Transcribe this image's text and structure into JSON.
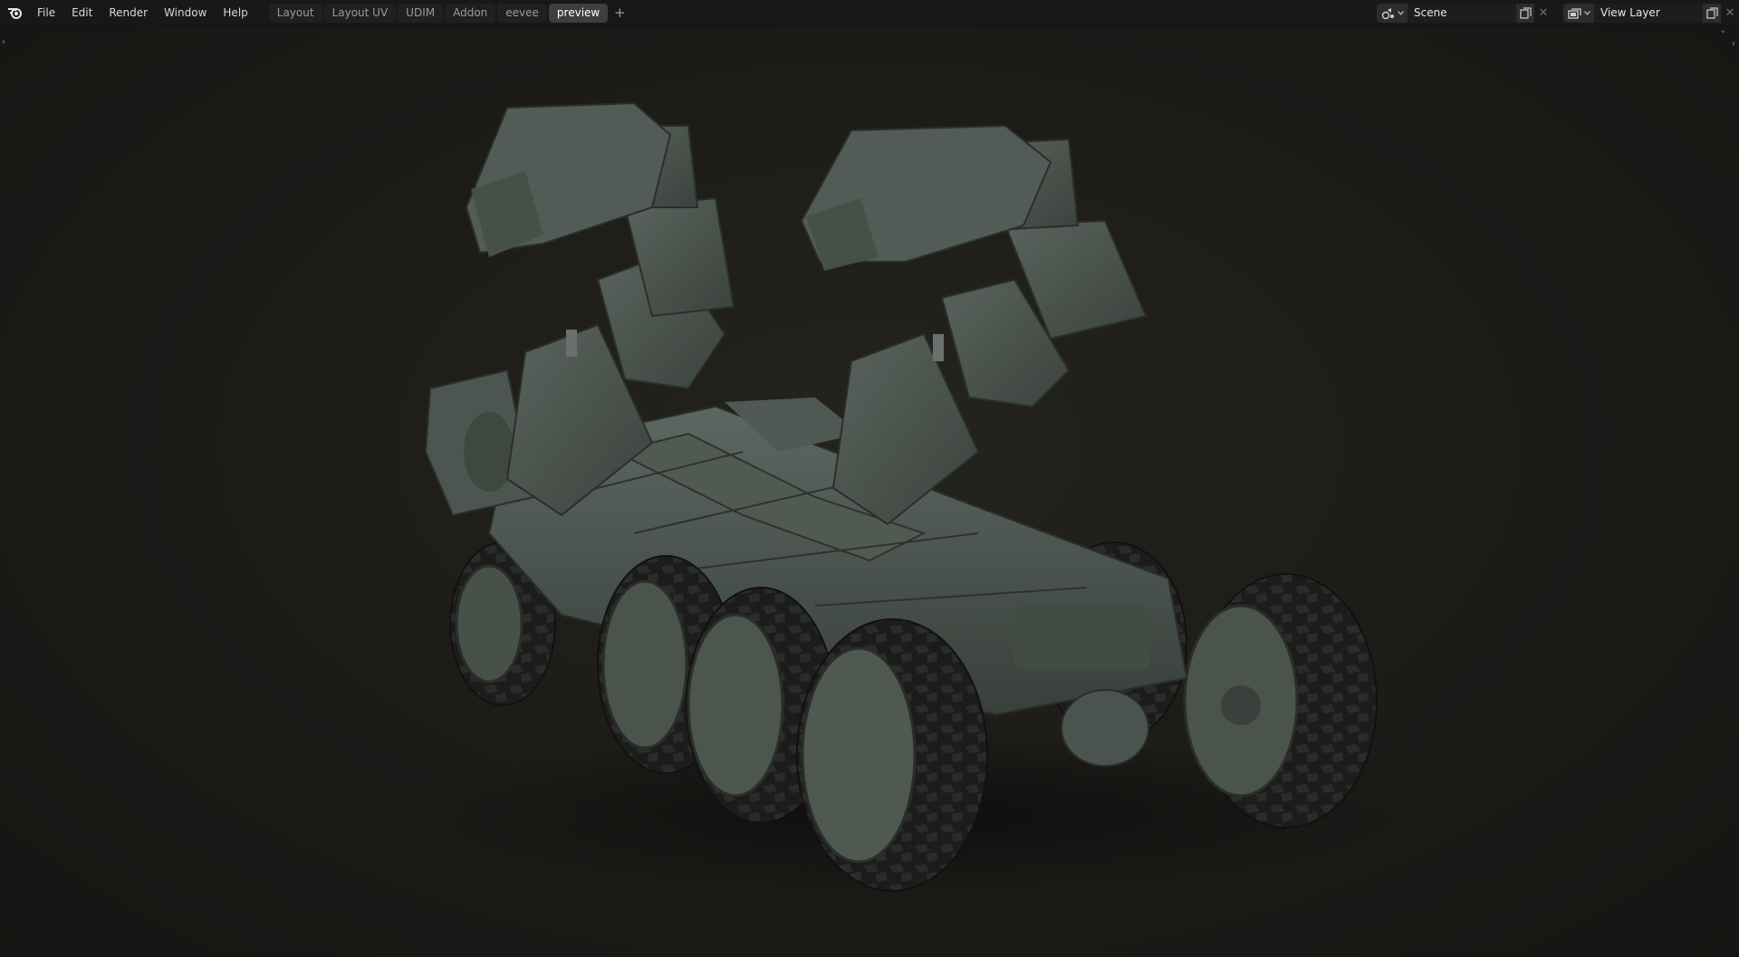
{
  "app": {
    "logo_icon": "blender-logo-icon"
  },
  "menu": {
    "items": [
      "File",
      "Edit",
      "Render",
      "Window",
      "Help"
    ]
  },
  "workspaces": {
    "tabs": [
      {
        "label": "Layout",
        "active": false
      },
      {
        "label": "Layout UV",
        "active": false
      },
      {
        "label": "UDIM",
        "active": false
      },
      {
        "label": "Addon",
        "active": false
      },
      {
        "label": "eevee",
        "active": false
      },
      {
        "label": "preview",
        "active": true
      }
    ],
    "add_label": "+"
  },
  "scene": {
    "icon": "scene-icon",
    "name": "Scene"
  },
  "view_layer": {
    "icon": "render-layers-icon",
    "name": "View Layer"
  },
  "viewport": {
    "left_toggle": "›",
    "right_toggle": "‹",
    "subject": "armored-six-wheel-vehicle-render"
  },
  "colors": {
    "topbar_bg": "#181818",
    "active_tab_bg": "#3e3e3e",
    "viewport_bg": "#1b1a17",
    "vehicle_body": "#4a534d",
    "tire": "#1f1f1e"
  }
}
